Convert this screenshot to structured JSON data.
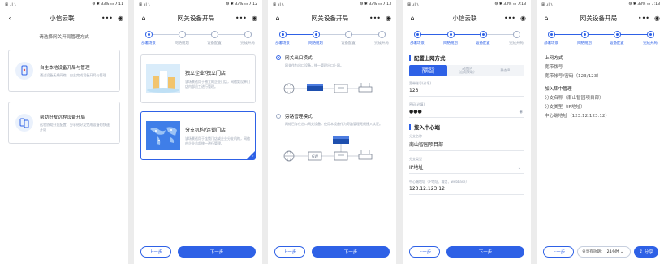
{
  "status": {
    "left": "ꕥ .ıl ⑊",
    "right": "⚙ ✱ 33% ▭ 7:11",
    "right_b": "⚙ ✱ 33% ▭ 7:12",
    "right_c": "⚙ ✱ 33% ▭ 7:13"
  },
  "app_title": "小信云联",
  "wizard_title": "网关设备开局",
  "steps": [
    "部署场景",
    "网络规划",
    "设备配置",
    "完成开局"
  ],
  "buttons": {
    "prev": "上一步",
    "next": "下一步",
    "share": "分享"
  },
  "screen1": {
    "hint": "请选择网关开局管理方式",
    "modes": [
      {
        "title": "自主本地设备开局与管理",
        "desc": "通过设备无线网络，自主完成设备开局与管理"
      },
      {
        "title": "帮助好友远程设备开局",
        "desc": "远程协助好友配置，分享给好友完成设备的快速开局"
      }
    ]
  },
  "screen2": {
    "scenes": [
      {
        "title": "独立企业/独立门店",
        "desc": "该场景适用于独立的企业门店，网络架设单门店内部员工进行管理。"
      },
      {
        "title": "分支机构/连锁门店",
        "desc": "该场景适用于连锁门店或企业分支机构，网络由企业总部统一进行管理。"
      }
    ]
  },
  "screen3": {
    "modes": [
      {
        "title": "网关出口模式",
        "desc": "网关作为出口设备，统一管理出口上网。"
      },
      {
        "title": "旁路管理模式",
        "desc": "网络已存在出口网关设备，使用本设备作为旁路管理无线接入认证。"
      }
    ],
    "diagram_label": "GW"
  },
  "screen4": {
    "sec1": "配置上网方式",
    "seg": [
      [
        "宽带拨号",
        "(PPPoE)"
      ],
      [
        "动态IP",
        "(自动获取)"
      ],
      [
        "静态IP",
        ""
      ]
    ],
    "fields1": [
      {
        "label": "宽带账号(必填)",
        "value": "123"
      },
      {
        "label": "密码(必填)",
        "value": "●●●"
      }
    ],
    "sec2": "接入中心端",
    "fields2": [
      {
        "label": "分支名称",
        "value": "南山智园项目部"
      },
      {
        "label": "分支类型",
        "value": "IP地址"
      },
      {
        "label": "中心端地址（IP地址、域名、webbase）",
        "value": "123.12.123.12"
      }
    ]
  },
  "screen5": {
    "h1": "上网方式",
    "l1": [
      "宽带拨号",
      "宽带帐号/密码（123/123）"
    ],
    "h2": "加入集中管理",
    "l2": [
      "分支名称（南山智园项目部）",
      "分支类型（IP地址）",
      "中心端地址（123.12.123.12）"
    ],
    "share_label": "分享有效期：",
    "share_value": "24小时 ⌄"
  },
  "colors": {
    "accent": "#2e61e6"
  },
  "icons": [
    "back-icon",
    "home-icon",
    "more-icon",
    "target-icon",
    "phone-router-icon",
    "remote-help-icon",
    "globe-icon",
    "router-icon",
    "switch-icon",
    "ap-icon",
    "share-icon"
  ]
}
